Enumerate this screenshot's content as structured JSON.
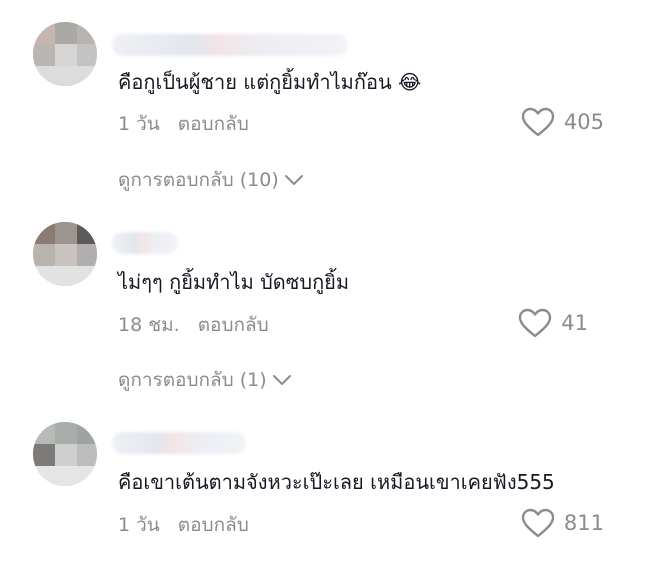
{
  "comments": [
    {
      "text": "คือกูเป็นผู้ชาย แต่กูยิ้มทำไมก๊อน 😂",
      "time": "1 วัน",
      "reply_label": "ตอบกลับ",
      "likes": "405",
      "view_replies": "ดูการตอบกลับ (10)"
    },
    {
      "text": "ไม่ๆๆ กูยิ้มทำไม บัดซบกูยิ้ม",
      "time": "18 ชม.",
      "reply_label": "ตอบกลับ",
      "likes": "41",
      "view_replies": "ดูการตอบกลับ (1)"
    },
    {
      "text": "คือเขาเต้นตามจังหวะเป๊ะเลย เหมือนเขาเคยฟัง555",
      "time": "1 วัน",
      "reply_label": "ตอบกลับ",
      "likes": "811"
    }
  ],
  "icons": {
    "like": "heart-outline-icon",
    "expand": "chevron-down-icon"
  },
  "colors": {
    "text": "#161823",
    "secondary": "#8a8b91"
  }
}
